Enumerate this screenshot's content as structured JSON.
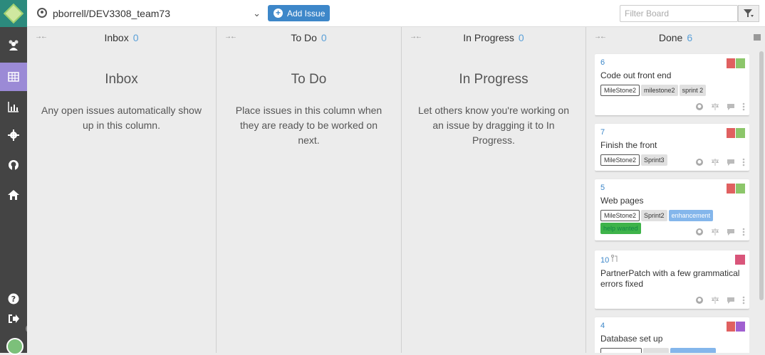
{
  "topbar": {
    "repo": "pborrell/DEV3308_team73",
    "add_issue": "Add Issue",
    "filter_placeholder": "Filter Board"
  },
  "sidebar": {
    "items": [
      {
        "icon": "users-icon"
      },
      {
        "icon": "board-icon",
        "active": true
      },
      {
        "icon": "chart-icon"
      },
      {
        "icon": "gear-icon"
      },
      {
        "icon": "github-icon"
      },
      {
        "icon": "home-icon"
      },
      {
        "icon": "help-icon"
      },
      {
        "icon": "logout-icon"
      }
    ]
  },
  "columns": [
    {
      "title": "Inbox",
      "count": "0",
      "empty_title": "Inbox",
      "empty_desc": "Any open issues automatically show up in this column."
    },
    {
      "title": "To Do",
      "count": "0",
      "empty_title": "To Do",
      "empty_desc": "Place issues in this column when they are ready to be worked on next."
    },
    {
      "title": "In Progress",
      "count": "0",
      "empty_title": "In Progress",
      "empty_desc": "Let others know you're working on an issue by dragging it to In Progress."
    },
    {
      "title": "Done",
      "count": "6"
    }
  ],
  "cards": [
    {
      "number": "6",
      "title": "Code out front end",
      "labels": [
        {
          "text": "MileStone2",
          "style": "outlined"
        },
        {
          "text": "milestone2",
          "style": "gray"
        },
        {
          "text": "sprint 2",
          "style": "gray"
        }
      ]
    },
    {
      "number": "7",
      "title": "Finish the front",
      "labels": [
        {
          "text": "MileStone2",
          "style": "outlined"
        },
        {
          "text": "Sprint3",
          "style": "gray"
        }
      ]
    },
    {
      "number": "5",
      "title": "Web pages",
      "labels": [
        {
          "text": "MileStone2",
          "style": "outlined"
        },
        {
          "text": "Sprint2",
          "style": "gray"
        },
        {
          "text": "enhancement",
          "style": "blue"
        },
        {
          "text": "help wanted",
          "style": "green"
        }
      ]
    },
    {
      "number": "10",
      "title": "PartnerPatch with a few grammatical errors fixed",
      "labels": []
    },
    {
      "number": "4",
      "title": "Database set up",
      "labels": []
    }
  ],
  "colors": {
    "accent": "#3d87c9",
    "sidebar": "#444444",
    "sidebar_active": "#9b8ad6",
    "count": "#5aa0d8"
  }
}
